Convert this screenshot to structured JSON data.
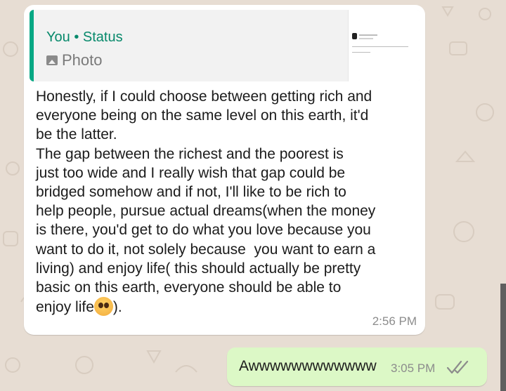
{
  "quoted_reply": {
    "author": "You",
    "separator": "•",
    "context": "Status",
    "media_type": "Photo",
    "media_icon": "photo-icon"
  },
  "incoming_message": {
    "text": "Honestly, if I could choose between getting rich and\neveryone being on the same level on this earth, it'd\nbe the latter.\nThe gap between the richest and the poorest is\njust too wide and I really wish that gap could be\nbridged somehow and if not, I'll like to be rich to\nhelp people, pursue actual dreams(when the money\nis there, you'd get to do what you love because you\nwant to do it, not solely because  you want to earn a\nliving) and enjoy life( this should actually be pretty\nbasic on this earth, everyone should be able to\nenjoy life",
    "emoji": "pleading-face-emoji",
    "text_end": ").",
    "time": "2:56 PM"
  },
  "outgoing_message": {
    "text": "Awwwwwwwwwwww",
    "time": "3:05 PM",
    "status_icon": "double-check-icon"
  },
  "colors": {
    "background": "#e7ddd3",
    "incoming_bubble": "#ffffff",
    "outgoing_bubble": "#dcf8c6",
    "quote_accent": "#06a884"
  }
}
